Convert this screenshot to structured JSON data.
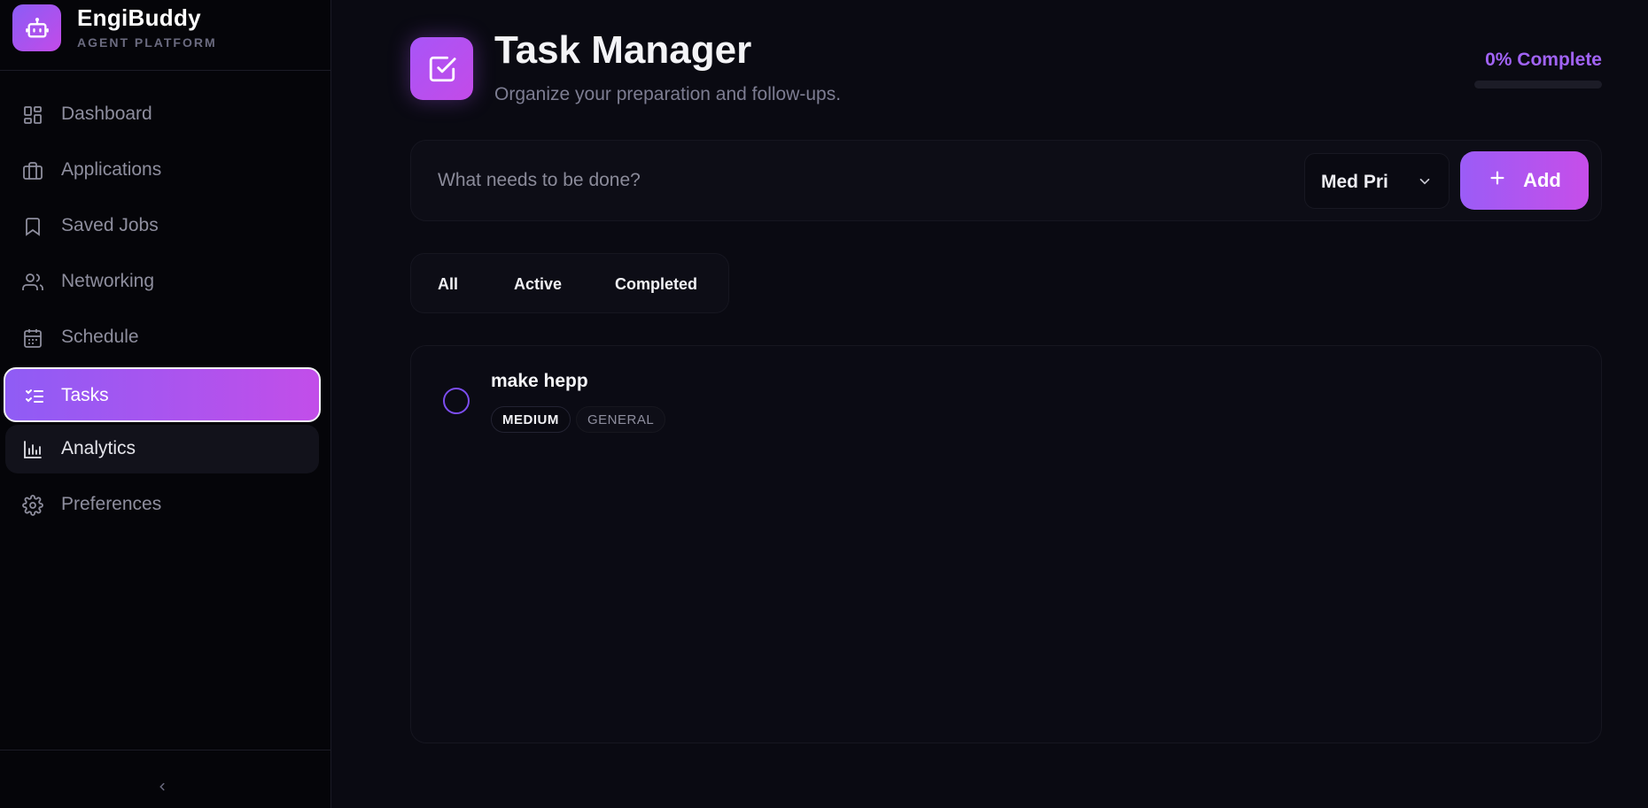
{
  "brand": {
    "name": "EngiBuddy",
    "subtitle": "AGENT PLATFORM",
    "logo_icon": "robot-icon"
  },
  "sidebar": {
    "items": [
      {
        "label": "Dashboard",
        "icon": "dashboard-icon"
      },
      {
        "label": "Applications",
        "icon": "briefcase-icon"
      },
      {
        "label": "Saved Jobs",
        "icon": "bookmark-icon"
      },
      {
        "label": "Networking",
        "icon": "users-icon"
      },
      {
        "label": "Schedule",
        "icon": "calendar-icon"
      },
      {
        "label": "Tasks",
        "icon": "list-checks-icon",
        "active": true
      },
      {
        "label": "Analytics",
        "icon": "bar-chart-icon"
      },
      {
        "label": "Preferences",
        "icon": "gear-icon"
      }
    ],
    "collapse_icon": "chevron-left-icon"
  },
  "header": {
    "title": "Task Manager",
    "subtitle": "Organize your preparation and follow-ups.",
    "icon": "checkbox-icon",
    "progress_text": "0% Complete",
    "progress_fraction": 0
  },
  "add_task": {
    "placeholder": "What needs to be done?",
    "value": "",
    "priority_selected": "Med Pri",
    "add_label": "Add"
  },
  "filters": {
    "tabs": [
      "All",
      "Active",
      "Completed"
    ]
  },
  "tasks": [
    {
      "title": "make hepp",
      "priority": "MEDIUM",
      "category": "GENERAL",
      "completed": false
    }
  ],
  "colors": {
    "accent": "#a163f5",
    "accent_gradient_end": "#c34be8",
    "background": "#0a0a12",
    "sidebar_bg": "#050509"
  }
}
